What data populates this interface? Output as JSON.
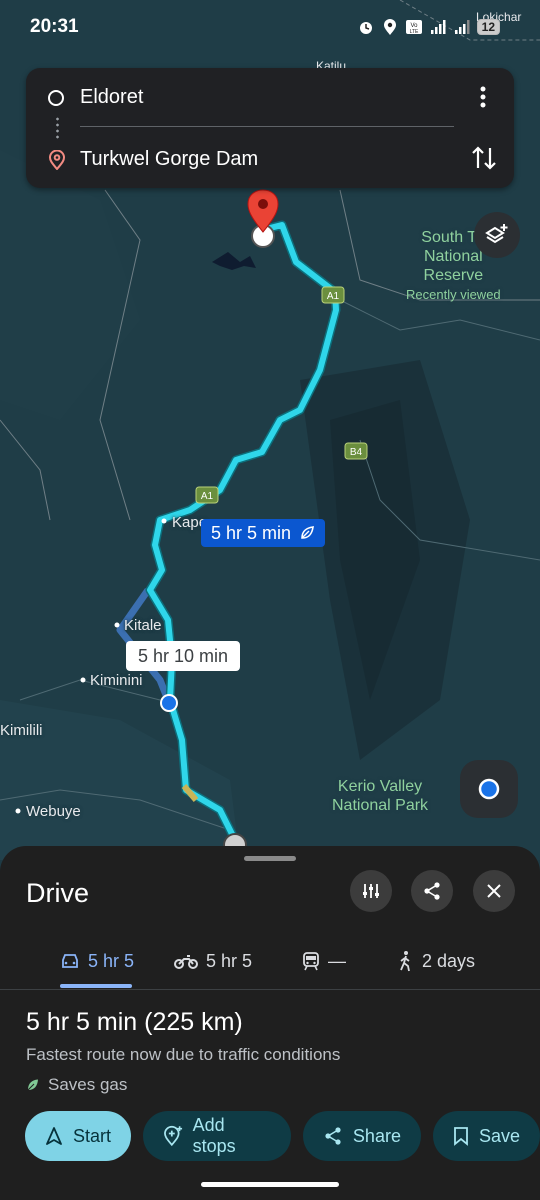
{
  "status_bar": {
    "time": "20:31",
    "battery": "12"
  },
  "search": {
    "origin": "Eldoret",
    "destination": "Turkwel Gorge Dam"
  },
  "map": {
    "labels": {
      "lokichar": "Lokichar",
      "katilu": "Katilu",
      "kapenguria": "Kape",
      "kitale": "Kitale",
      "kiminini": "Kiminini",
      "kimilili": "Kimilili",
      "webuye": "Webuye"
    },
    "park_south_turkana": {
      "line1": "South Tu",
      "line2": "National",
      "line3": "Reserve",
      "note": "Recently viewed"
    },
    "park_kerio": {
      "line1": "Kerio Valley",
      "line2": "National Park"
    },
    "road_badges": {
      "a1_north": "A1",
      "a1_south": "A1",
      "b4": "B4"
    },
    "route_primary_time": "5 hr 5 min",
    "route_alt_time": "5 hr 10 min"
  },
  "sheet": {
    "title": "Drive",
    "tabs": [
      {
        "label": "5 hr 5",
        "icon": "car-icon"
      },
      {
        "label": "5 hr 5",
        "icon": "motorcycle-icon"
      },
      {
        "label": "—",
        "icon": "transit-icon"
      },
      {
        "label": "2 days",
        "icon": "walk-icon"
      }
    ],
    "summary_time": "5 hr 5 min",
    "summary_distance": "(225 km)",
    "summary_note": "Fastest route now due to traffic conditions",
    "eco_label": "Saves gas",
    "actions": {
      "start": "Start",
      "add_stops": "Add stops",
      "share": "Share",
      "save": "Save"
    }
  },
  "colors": {
    "route": "#2fd6ea",
    "route_alt": "#3b6fb0",
    "chip_primary": "#0b57d0",
    "start_button": "#7fd3e6",
    "accent_tab": "#8ab4f8",
    "eco_green": "#81c995",
    "destination_pin": "#ea4335"
  }
}
